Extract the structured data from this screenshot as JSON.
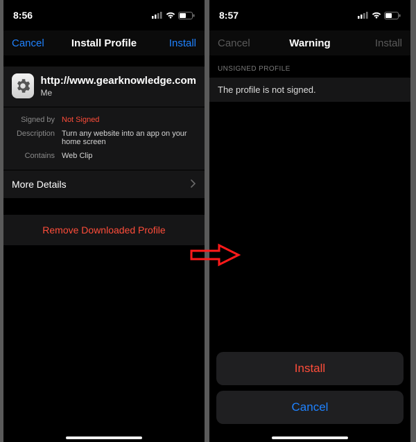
{
  "left": {
    "status": {
      "time": "8:56"
    },
    "nav": {
      "cancel": "Cancel",
      "title": "Install Profile",
      "install": "Install"
    },
    "profile": {
      "title": "http://www.gearknowledge.com",
      "subtitle": "Me",
      "rows": {
        "signed_by": {
          "label": "Signed by",
          "value": "Not Signed"
        },
        "description": {
          "label": "Description",
          "value": "Turn any website into an app on your home screen"
        },
        "contains": {
          "label": "Contains",
          "value": "Web Clip"
        }
      },
      "more": "More Details",
      "remove": "Remove Downloaded Profile"
    }
  },
  "right": {
    "status": {
      "time": "8:57"
    },
    "nav": {
      "cancel": "Cancel",
      "title": "Warning",
      "install": "Install"
    },
    "section_label": "UNSIGNED PROFILE",
    "message": "The profile is not signed.",
    "sheet": {
      "install": "Install",
      "cancel": "Cancel"
    }
  }
}
